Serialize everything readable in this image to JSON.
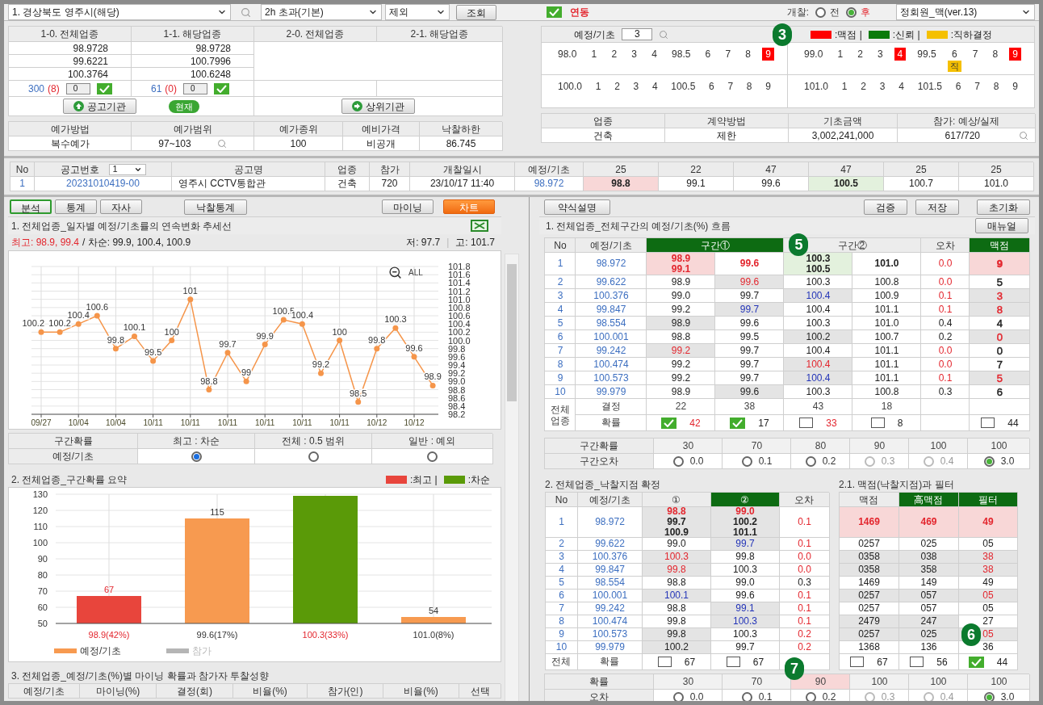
{
  "toolbar": {
    "region": "1. 경상북도 영주시(해당)",
    "period": "2h 초과(기본)",
    "exclude": "제외",
    "query_button": "조회",
    "linked": {
      "label": "연동",
      "checked": true
    },
    "open_label": "개찰:",
    "open_options": [
      {
        "label": "전",
        "selected": false
      },
      {
        "label": "후",
        "selected": true
      }
    ],
    "version": "정회원_맥(ver.13)"
  },
  "upper_left": {
    "headers": [
      "1-0. 전체업종",
      "1-1. 해당업종",
      "2-0. 전체업종",
      "2-1. 해당업종"
    ],
    "columns": [
      [
        "98.9728",
        "99.6221",
        "100.3764"
      ],
      [
        "98.9728",
        "100.7996",
        "100.6248"
      ]
    ],
    "counters": [
      {
        "count": "300",
        "extra": "(8)",
        "input": "0",
        "checked": true
      },
      {
        "count": "61",
        "extra": "(0)",
        "input": "0",
        "checked": true
      }
    ],
    "buttons": [
      {
        "label": "공고기관",
        "kind": "up"
      },
      {
        "label": "현재",
        "kind": "pill"
      },
      {
        "label": "상위기관",
        "kind": "right"
      }
    ]
  },
  "price": {
    "headers": [
      "예가방법",
      "예가범위",
      "예가종위",
      "예비가격",
      "낙찰하한"
    ],
    "values": [
      "복수예가",
      "97~103",
      "100",
      "비공개",
      "86.745"
    ]
  },
  "upper_right": {
    "label": "예정/기초",
    "input": "3",
    "badge": "3",
    "legend": [
      {
        "label": ":맥점 |",
        "color": "#ff0000"
      },
      {
        "label": ":신뢰 |",
        "color": "#0a7a0a"
      },
      {
        "label": ":직하결정",
        "color": "#f5c000"
      }
    ],
    "blocks": [
      [
        "98.0",
        "1",
        "2",
        "3",
        "4",
        "98.5",
        "6",
        "7",
        "8",
        {
          "text": "9",
          "color": "#ff0000"
        }
      ],
      [
        "99.0",
        "1",
        "2",
        "3",
        {
          "text": "4",
          "color": "#ff0000"
        },
        "99.5",
        {
          "text": "6",
          "note": {
            "text": "직",
            "color": "#f5c000"
          }
        },
        "7",
        "8",
        {
          "text": "9",
          "color": "#ff0000"
        }
      ],
      [
        "100.0",
        "1",
        "2",
        "3",
        "4",
        "100.5",
        "6",
        "7",
        "8",
        "9"
      ],
      [
        "101.0",
        "1",
        "2",
        "3",
        "4",
        "101.5",
        "6",
        "7",
        "8",
        "9"
      ]
    ]
  },
  "info": {
    "headers": [
      "업종",
      "계약방법",
      "기초금액",
      "참가: 예상/실제"
    ],
    "values": [
      "건축",
      "제한",
      "3,002,241,000",
      "617/720"
    ]
  },
  "bid_table": {
    "columns": [
      "No",
      "공고번호",
      "공고명",
      "업종",
      "참가",
      "개찰일시",
      "예정/기초",
      "25",
      "22",
      "47",
      "47",
      "25",
      "25"
    ],
    "number_filter": "1",
    "rows": [
      [
        "1",
        "20231010419-00",
        "영주시 CCTV통합관",
        "건축",
        "720",
        "23/10/17 11:40",
        "98.972",
        {
          "text": "98.8",
          "marked": true,
          "bold": true
        },
        "99.1",
        "99.6",
        {
          "text": "100.5",
          "matched": true,
          "bold": true
        },
        "100.7",
        "101.0"
      ]
    ]
  },
  "left": {
    "tabs": [
      {
        "label": "분석",
        "selected": true
      },
      {
        "label": "통계",
        "selected": false
      },
      {
        "label": "자사",
        "selected": false
      }
    ],
    "stats_button": "낙찰통계",
    "view_tabs": [
      {
        "label": "마이닝",
        "selected": false
      },
      {
        "label": "차트",
        "selected": true
      }
    ],
    "section1": {
      "title": "1. 전체업종_일자별 예정/기초률의 연속변화 추세선",
      "summary": {
        "best": "최고: 98.9, 99.4",
        "next": "/ 차순: 99.9, 100.4, 100.9",
        "low": "저: 97.7",
        "separator": "|",
        "high": "고: 101.7"
      },
      "zoom_label": "ALL",
      "chart_data": {
        "type": "line",
        "grid": true,
        "categories": [
          "09/27",
          null,
          "10/04",
          null,
          "10/04",
          null,
          "10/11",
          null,
          "10/11",
          null,
          "10/11",
          null,
          "10/11",
          null,
          "10/11",
          null,
          "10/11",
          null,
          "10/12",
          null,
          "10/12",
          null
        ],
        "series": [
          {
            "color": "#f5954a",
            "marker": "circle",
            "values": [
              100.2,
              100.2,
              100.4,
              100.6,
              99.8,
              100.1,
              99.5,
              100,
              101,
              98.8,
              99.7,
              99,
              99.9,
              100.5,
              100.4,
              99.2,
              100,
              98.5,
              99.8,
              100.3,
              99.6,
              98.9
            ]
          }
        ],
        "ylim": [
          98.2,
          101.8
        ],
        "yticks": [
          98.2,
          98.4,
          98.6,
          98.8,
          {
            "value": 99,
            "label": "99.0"
          },
          99.2,
          99.4,
          99.6,
          99.8,
          {
            "value": 100,
            "label": "100.0"
          },
          100.2,
          100.4,
          100.6,
          100.8,
          {
            "value": 101,
            "label": "101.0"
          },
          101.2,
          101.4,
          101.6,
          101.8
        ],
        "data_labels": true
      }
    },
    "range_table": {
      "headers": [
        "구간확률",
        "최고 : 차순",
        "전체 : 0.5 범위",
        "일반 : 예외"
      ],
      "row_label": "예정/기초",
      "options": [
        {
          "selected": true
        },
        {
          "selected": false
        },
        {
          "selected": false
        }
      ]
    },
    "section2": {
      "title": "2. 전체업종_구간확률 요약",
      "chart_data": {
        "type": "bar",
        "grid": true,
        "categories": [
          "98.9(42%)",
          "99.6(17%)",
          "100.3(33%)",
          "101.0(8%)"
        ],
        "series": [
          {
            "name": ":최고 |",
            "color": "#e8453c",
            "values": [
              67,
              null,
              null,
              null
            ]
          },
          {
            "name": ":차순",
            "color": "#5a9a08",
            "values": [
              null,
              null,
              129,
              null
            ]
          },
          {
            "name": "예정/기초",
            "color": "#f79a50",
            "values": [
              null,
              115,
              null,
              54
            ]
          }
        ],
        "ylim": [
          50,
          130
        ],
        "yticks": [
          50,
          60,
          70,
          80,
          90,
          100,
          110,
          120,
          130
        ],
        "value_labels": [
          "67",
          "115",
          null,
          "54"
        ]
      },
      "extra_legend": {
        "label": "참가",
        "color": "#b5b5b5",
        "disabled": true
      }
    },
    "section3": {
      "title": "3. 전체업종_예정/기초(%)별 마이닝 확률과 참가자 투찰성향",
      "columns": [
        "예정/기초",
        "마이닝(%)",
        "결정(회)",
        "비율(%)",
        "참가(인)",
        "비율(%)",
        "선택"
      ]
    }
  },
  "right": {
    "buttons_left": [
      "약식설명"
    ],
    "buttons_right": [
      "검증",
      "저장",
      "초기화"
    ],
    "flow": {
      "title": "1. 전체업종_전체구간의 예정/기초(%) 흐름",
      "manual_button": "매뉴얼",
      "badge": "5",
      "columns": {
        "no": {
          "label": "No",
          "accent": false
        },
        "base": {
          "label": "예정/기초",
          "accent": false
        },
        "zone1": {
          "label": "구간①",
          "accent": true
        },
        "zone2": {
          "label": "구간②",
          "accent": false
        },
        "error": {
          "label": "오차",
          "accent": false
        },
        "key_point": {
          "label": "맥점",
          "accent": true
        }
      },
      "rows": [
        {
          "no": "1",
          "base": "98.972",
          "zone1": [
            {
              "text": "98.9\n99.1",
              "color": "#e3262e",
              "marked": true,
              "bold": true
            },
            {
              "text": "99.6",
              "color": "#e3262e",
              "bold": true
            }
          ],
          "zone2": [
            {
              "text": "100.3\n100.5",
              "matched": true,
              "bold": true
            },
            {
              "text": "101.0",
              "bold": true
            }
          ],
          "error": {
            "text": "0.0",
            "color": "#e3262e"
          },
          "key_point": {
            "text": "9",
            "color": "#e3262e",
            "marked": true,
            "bold": true
          }
        },
        {
          "no": "2",
          "base": "99.622",
          "zone1": [
            "98.9",
            {
              "text": "99.6",
              "color": "#e3262e",
              "shaded": true
            }
          ],
          "zone2": [
            "100.3",
            "100.8"
          ],
          "error": {
            "text": "0.0",
            "color": "#e3262e"
          },
          "key_point": "5"
        },
        {
          "no": "3",
          "base": "100.376",
          "zone1": [
            "99.0",
            "99.7"
          ],
          "zone2": [
            {
              "text": "100.4",
              "color": "#2435b8",
              "shaded": true
            },
            "100.9"
          ],
          "error": {
            "text": "0.1",
            "color": "#e3262e"
          },
          "key_point": {
            "text": "3",
            "color": "#e3262e",
            "shaded": true
          }
        },
        {
          "no": "4",
          "base": "99.847",
          "zone1": [
            "99.2",
            {
              "text": "99.7",
              "color": "#2435b8",
              "shaded": true
            }
          ],
          "zone2": [
            "100.4",
            "101.1"
          ],
          "error": {
            "text": "0.1",
            "color": "#e3262e"
          },
          "key_point": {
            "text": "8",
            "color": "#e3262e",
            "shaded": true
          }
        },
        {
          "no": "5",
          "base": "98.554",
          "zone1": [
            {
              "text": "98.9",
              "shaded": true
            },
            "99.6"
          ],
          "zone2": [
            "100.3",
            "101.0"
          ],
          "error": "0.4",
          "key_point": "4"
        },
        {
          "no": "6",
          "base": "100.001",
          "zone1": [
            "98.8",
            "99.5"
          ],
          "zone2": [
            {
              "text": "100.2",
              "shaded": true
            },
            "100.7"
          ],
          "error": "0.2",
          "key_point": {
            "text": "0",
            "color": "#e3262e",
            "shaded": true
          }
        },
        {
          "no": "7",
          "base": "99.242",
          "zone1": [
            {
              "text": "99.2",
              "color": "#e3262e",
              "shaded": true
            },
            "99.7"
          ],
          "zone2": [
            "100.4",
            "101.1"
          ],
          "error": {
            "text": "0.0",
            "color": "#e3262e"
          },
          "key_point": "0"
        },
        {
          "no": "8",
          "base": "100.474",
          "zone1": [
            "99.2",
            "99.7"
          ],
          "zone2": [
            {
              "text": "100.4",
              "color": "#e3262e",
              "shaded": true
            },
            "101.1"
          ],
          "error": {
            "text": "0.0",
            "color": "#e3262e"
          },
          "key_point": "7"
        },
        {
          "no": "9",
          "base": "100.573",
          "zone1": [
            "99.2",
            "99.7"
          ],
          "zone2": [
            {
              "text": "100.4",
              "color": "#2435b8",
              "shaded": true
            },
            "101.1"
          ],
          "error": {
            "text": "0.1",
            "color": "#e3262e"
          },
          "key_point": {
            "text": "5",
            "color": "#e3262e",
            "shaded": true
          }
        },
        {
          "no": "10",
          "base": "99.979",
          "zone1": [
            "98.9",
            {
              "text": "99.6",
              "shaded": true
            }
          ],
          "zone2": [
            "100.3",
            "100.8"
          ],
          "error": "0.3",
          "key_point": "6"
        }
      ],
      "group_label": "전체 업종",
      "decided_label": "결정",
      "decided": [
        "22",
        "38",
        "43",
        "18"
      ],
      "prob_label": "확률",
      "probs": [
        {
          "checked": true,
          "value": "42",
          "color": "#e3262e"
        },
        {
          "checked": true,
          "value": "17",
          "color": "#222222"
        },
        {
          "checked": false,
          "value": "33",
          "color": "#e3262e"
        },
        {
          "checked": false,
          "value": "8",
          "color": "#222222"
        }
      ],
      "edge_prob": {
        "checked": false,
        "value": "44"
      }
    },
    "range": {
      "label_top": "구간확률",
      "values": [
        {
          "text": "30"
        },
        {
          "text": "70"
        },
        {
          "text": "80"
        },
        {
          "text": "90"
        },
        {
          "text": "100"
        },
        {
          "text": "100"
        }
      ],
      "label_bottom": "구간오차",
      "options": [
        {
          "label": "0.0",
          "selected": false,
          "disabled": false
        },
        {
          "label": "0.1",
          "selected": false,
          "disabled": false
        },
        {
          "label": "0.2",
          "selected": false,
          "disabled": false
        },
        {
          "label": "0.3",
          "selected": false,
          "disabled": true
        },
        {
          "label": "0.4",
          "selected": false,
          "disabled": true
        },
        {
          "label": "3.0",
          "selected": true,
          "disabled": false
        }
      ]
    },
    "confirm": {
      "title": "2. 전체업종_낙찰지점 확정",
      "badge": "7",
      "columns": [
        {
          "label": "No",
          "accent": false
        },
        {
          "label": "예정/기초",
          "accent": false
        },
        {
          "label": "①",
          "accent": false
        },
        {
          "label": "②",
          "accent": true
        },
        {
          "label": "오차",
          "accent": false
        }
      ],
      "rows": [
        [
          "1",
          "98.972",
          {
            "lines": [
              {
                "text": "98.8",
                "color": "#e3262e"
              },
              {
                "text": "99.7"
              },
              {
                "text": "100.9"
              }
            ],
            "shaded": true,
            "bold": true
          },
          {
            "lines": [
              {
                "text": "99.0",
                "color": "#e3262e"
              },
              {
                "text": "100.2"
              },
              {
                "text": "101.1"
              }
            ],
            "shaded": true,
            "bold": true
          },
          {
            "text": "0.1",
            "color": "#e3262e"
          }
        ],
        [
          "2",
          "99.622",
          "99.0",
          {
            "text": "99.7",
            "color": "#2435b8",
            "shaded": true
          },
          {
            "text": "0.1",
            "color": "#e3262e"
          }
        ],
        [
          "3",
          "100.376",
          {
            "text": "100.3",
            "color": "#e3262e",
            "shaded": true
          },
          "99.8",
          {
            "text": "0.0",
            "color": "#e3262e"
          }
        ],
        [
          "4",
          "99.847",
          {
            "text": "99.8",
            "color": "#e3262e",
            "shaded": true
          },
          "100.3",
          {
            "text": "0.0",
            "color": "#e3262e"
          }
        ],
        [
          "5",
          "98.554",
          "98.8",
          "99.0",
          "0.3"
        ],
        [
          "6",
          "100.001",
          {
            "text": "100.1",
            "color": "#2435b8",
            "shaded": true
          },
          "99.6",
          {
            "text": "0.1",
            "color": "#e3262e"
          }
        ],
        [
          "7",
          "99.242",
          "98.8",
          {
            "text": "99.1",
            "color": "#2435b8",
            "shaded": true
          },
          {
            "text": "0.1",
            "color": "#e3262e"
          }
        ],
        [
          "8",
          "100.474",
          "99.8",
          {
            "text": "100.3",
            "color": "#2435b8",
            "shaded": true
          },
          {
            "text": "0.1",
            "color": "#e3262e"
          }
        ],
        [
          "9",
          "100.573",
          {
            "text": "99.8",
            "shaded": true
          },
          "100.3",
          {
            "text": "0.2",
            "color": "#e3262e"
          }
        ],
        [
          "10",
          "99.979",
          {
            "text": "100.2",
            "shaded": true
          },
          "99.7",
          {
            "text": "0.2",
            "color": "#e3262e"
          }
        ]
      ],
      "total_label": "전체",
      "prob_label": "확률",
      "probs": [
        {
          "checked": false,
          "value": "67"
        },
        {
          "checked": false,
          "value": "67"
        }
      ]
    },
    "filter": {
      "title": "2.1. 맥점(낙찰지점)과 필터",
      "badge": "6",
      "columns": [
        {
          "label": "맥점",
          "accent": false
        },
        {
          "label": "高맥점",
          "accent": true
        },
        {
          "label": "필터",
          "accent": true
        }
      ],
      "rows": [
        [
          {
            "text": "1469",
            "color": "#e3262e",
            "marked": true,
            "bold": true
          },
          {
            "text": "469",
            "color": "#e3262e",
            "marked": true,
            "bold": true
          },
          {
            "text": "49",
            "color": "#e3262e",
            "marked": true,
            "bold": true
          }
        ],
        [
          "0257",
          "025",
          "05"
        ],
        [
          {
            "text": "0358",
            "shaded": true
          },
          {
            "text": "038",
            "shaded": true
          },
          {
            "text": "38",
            "color": "#e3262e",
            "shaded": true
          }
        ],
        [
          {
            "text": "0358",
            "shaded": true
          },
          {
            "text": "358",
            "shaded": true
          },
          {
            "text": "38",
            "color": "#e3262e",
            "shaded": true
          }
        ],
        [
          "1469",
          "149",
          "49"
        ],
        [
          {
            "text": "0257",
            "shaded": true
          },
          {
            "text": "057",
            "shaded": true
          },
          {
            "text": "05",
            "color": "#e3262e",
            "shaded": true
          }
        ],
        [
          "0257",
          "057",
          "05"
        ],
        [
          {
            "text": "2479",
            "shaded": true
          },
          {
            "text": "247",
            "shaded": true
          },
          "27"
        ],
        [
          {
            "text": "0257",
            "shaded": true
          },
          {
            "text": "025",
            "shaded": true
          },
          {
            "text": "05",
            "color": "#e3262e",
            "shaded": true
          }
        ],
        [
          "1368",
          "136",
          "36"
        ]
      ],
      "probs": [
        {
          "checked": false,
          "value": "67"
        },
        {
          "checked": false,
          "value": "56"
        },
        {
          "checked": true,
          "value": "44"
        }
      ]
    },
    "bottom": {
      "label_top": "확률",
      "values": [
        {
          "text": "30"
        },
        {
          "text": "70"
        },
        {
          "text": "90",
          "marked": true
        },
        {
          "text": "100"
        },
        {
          "text": "100"
        },
        {
          "text": "100"
        }
      ],
      "label_bottom": "오차",
      "options": [
        {
          "label": "0.0",
          "selected": false,
          "disabled": false
        },
        {
          "label": "0.1",
          "selected": false,
          "disabled": false
        },
        {
          "label": "0.2",
          "selected": false,
          "disabled": false
        },
        {
          "label": "0.3",
          "selected": false,
          "disabled": true
        },
        {
          "label": "0.4",
          "selected": false,
          "disabled": true
        },
        {
          "label": "3.0",
          "selected": true,
          "disabled": false
        }
      ]
    }
  }
}
